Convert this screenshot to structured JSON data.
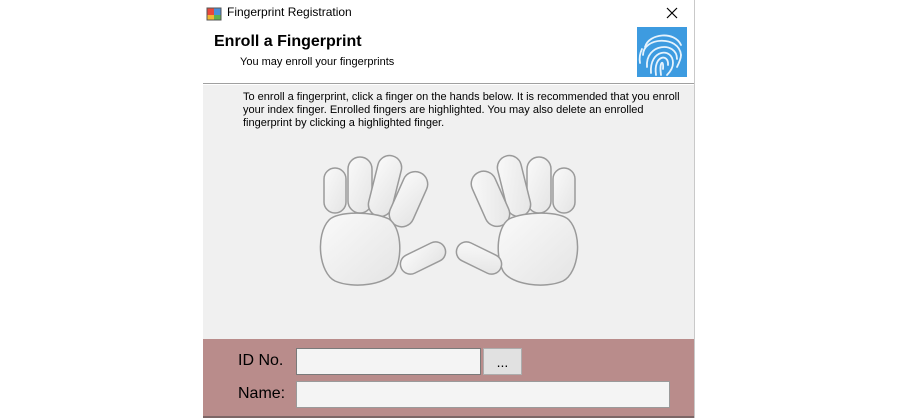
{
  "window": {
    "title": "Fingerprint Registration",
    "close_symbol": "✕"
  },
  "header": {
    "title": "Enroll a Fingerprint",
    "subtitle": "You may enroll your fingerprints",
    "logo_icon": "fingerprint-icon",
    "logo_color": "#3d9be0"
  },
  "content": {
    "instructions": "To enroll a fingerprint, click a finger on the hands below. It is recommended that you enroll your index finger. Enrolled fingers are highlighted. You may also delete an enrolled fingerprint by clicking a highlighted finger."
  },
  "form": {
    "id_label": "ID No.",
    "id_value": "",
    "browse_label": "...",
    "name_label": "Name:",
    "name_value": ""
  },
  "colors": {
    "content_bg": "#f0f0f0",
    "form_bg": "#b98c8b",
    "hand_fill": "#f2f2f2",
    "hand_stroke": "#9a9a9a"
  }
}
